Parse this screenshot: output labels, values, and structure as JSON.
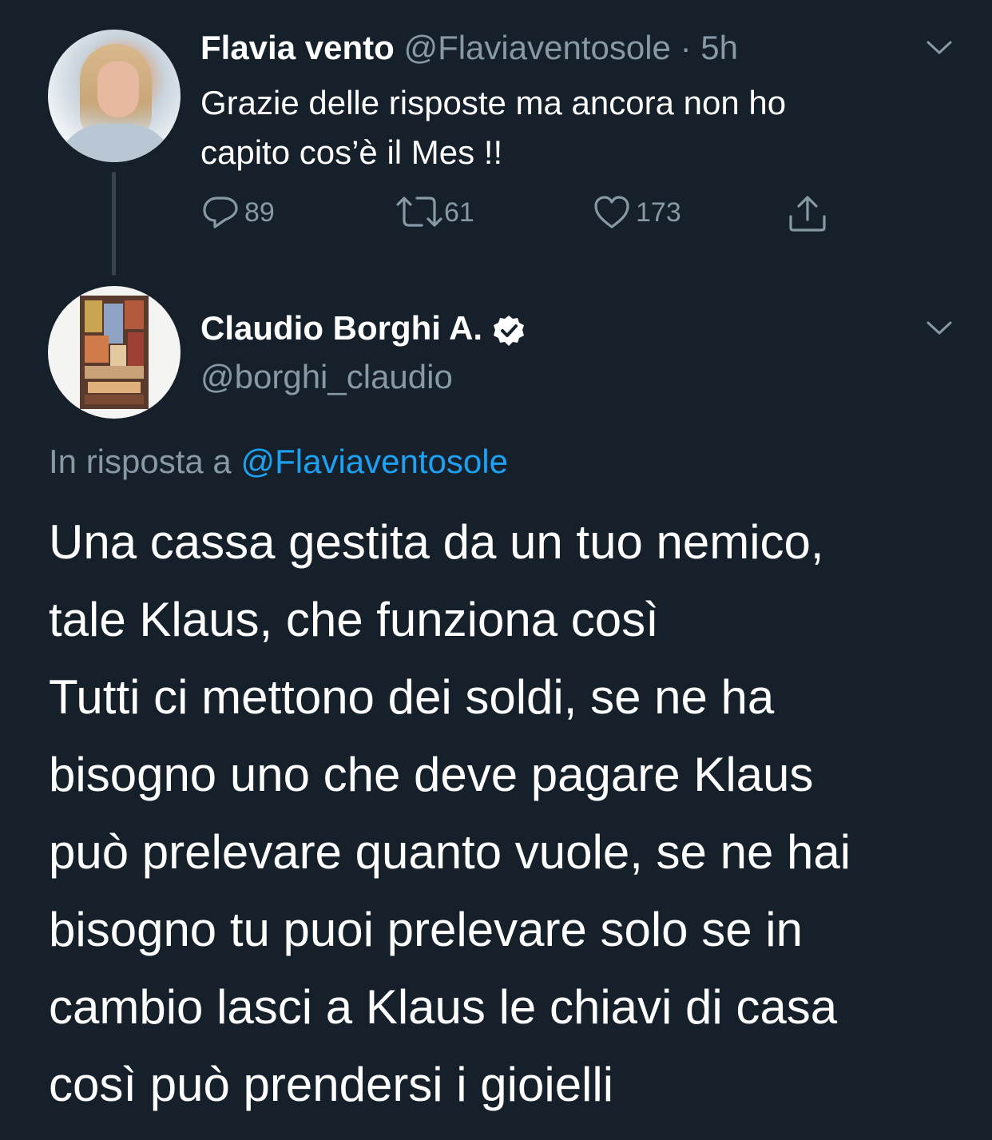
{
  "colors": {
    "background": "#15202b",
    "primary_text": "#ffffff",
    "secondary_text": "#8899a6",
    "accent": "#1da1f2",
    "thread_line": "#38444d"
  },
  "tweet1": {
    "display_name": "Flavia vento",
    "handle": "@Flaviaventosole",
    "separator": " · ",
    "time": "5h",
    "text": "Grazie delle risposte ma ancora non ho\ncapito cos’è il Mes !!",
    "avatar_icon": "profile-photo",
    "menu_icon": "chevron-down-icon",
    "actions": {
      "reply": {
        "icon": "reply-icon",
        "count": "89"
      },
      "retweet": {
        "icon": "retweet-icon",
        "count": "61"
      },
      "like": {
        "icon": "heart-icon",
        "count": "173"
      },
      "share": {
        "icon": "share-icon"
      }
    }
  },
  "tweet2": {
    "display_name": "Claudio Borghi A.",
    "verified_icon": "verified-badge-icon",
    "handle": "@borghi_claudio",
    "menu_icon": "chevron-down-icon",
    "reply_prefix": "In risposta a ",
    "reply_mention": "@Flaviaventosole",
    "text": "Una cassa gestita da un tuo nemico,\ntale Klaus, che funziona così\nTutti ci mettono dei soldi, se ne ha\nbisogno uno che deve pagare Klaus\npuò prelevare quanto vuole, se ne hai\nbisogno tu puoi prelevare solo se in\ncambio lasci a Klaus le chiavi di casa\ncosì può prendersi i gioielli"
  }
}
